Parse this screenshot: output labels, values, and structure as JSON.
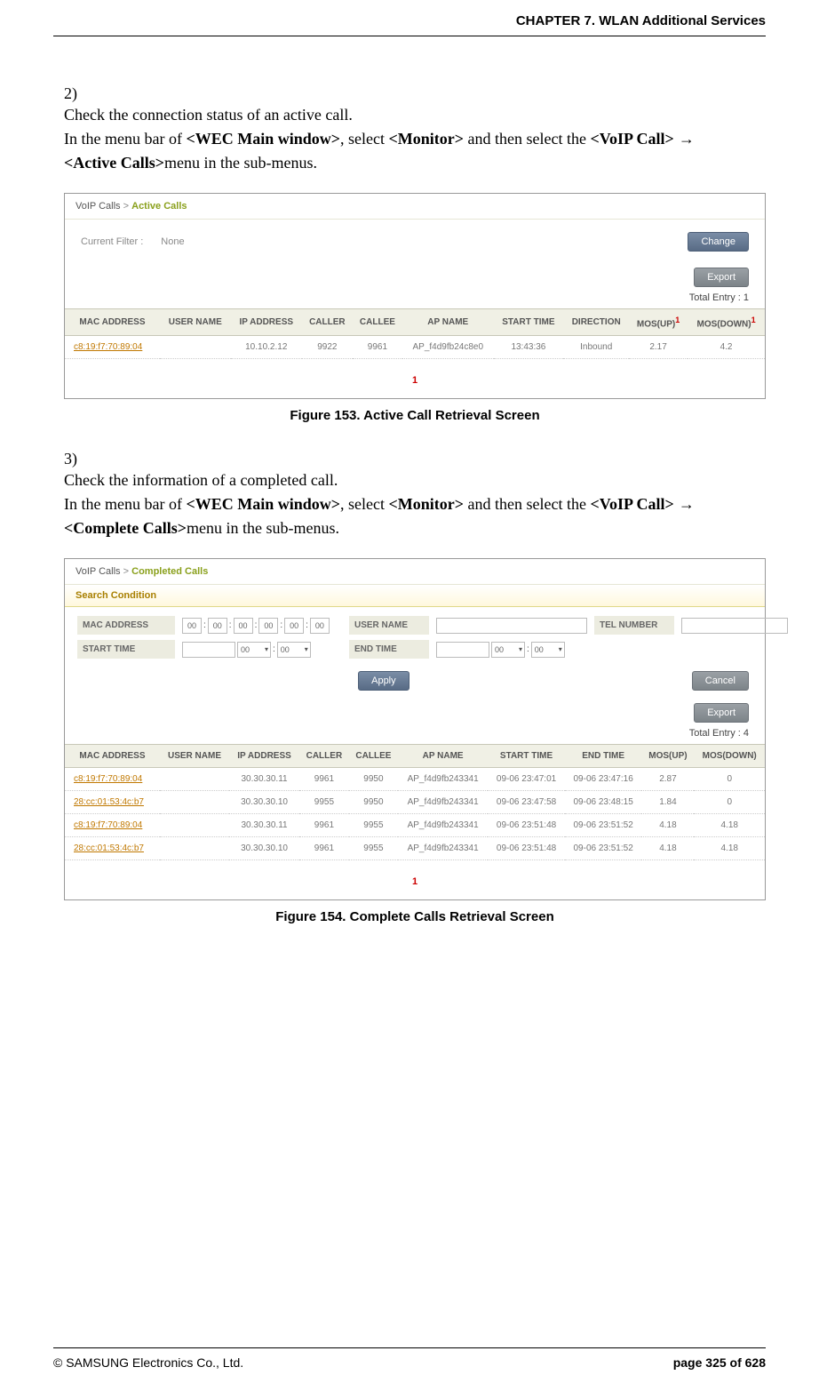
{
  "header": "CHAPTER 7. WLAN Additional Services",
  "step2": {
    "num": "2)",
    "line1": "Check the connection status of an active call.",
    "line2a": "In the menu bar of ",
    "wec": "<WEC Main window>",
    "line2b": ", select ",
    "monitor": "<Monitor>",
    "line2c": " and then select the ",
    "voip": "<VoIP Call>",
    "arrow": " → ",
    "active": "<Active Calls>",
    "line2d": "menu in the sub-menus."
  },
  "fig1": {
    "crumb1": "VoIP Calls",
    "crumb_sep": ">",
    "crumb2": "Active Calls",
    "filter_label": "Current Filter :",
    "filter_value": "None",
    "change_btn": "Change",
    "export_btn": "Export",
    "total": "Total Entry : 1",
    "headers": [
      "MAC ADDRESS",
      "USER NAME",
      "IP ADDRESS",
      "CALLER",
      "CALLEE",
      "AP NAME",
      "START TIME",
      "DIRECTION",
      "MOS(UP)",
      "MOS(DOWN)"
    ],
    "row": {
      "mac": "c8:19:f7:70:89:04",
      "user": "",
      "ip": "10.10.2.12",
      "caller": "9922",
      "callee": "9961",
      "ap": "AP_f4d9fb24c8e0",
      "start": "13:43:36",
      "dir": "Inbound",
      "mosup": "2.17",
      "mosdn": "4.2"
    },
    "pager": "1",
    "caption": "Figure 153. Active Call Retrieval Screen"
  },
  "step3": {
    "num": "3)",
    "line1": "Check the information of a completed call.",
    "line2a": "In the menu bar of ",
    "wec": "<WEC Main window>",
    "line2b": ", select ",
    "monitor": "<Monitor>",
    "line2c": " and then select the ",
    "voip": "<VoIP Call>",
    "arrow": " → ",
    "complete": "<Complete Calls>",
    "line2d": "menu in the sub-menus."
  },
  "fig2": {
    "crumb1": "VoIP Calls",
    "crumb_sep": ">",
    "crumb2": "Completed Calls",
    "search_tab": "Search Condition",
    "labels": {
      "mac": "MAC ADDRESS",
      "user": "USER NAME",
      "tel": "TEL NUMBER",
      "start": "START TIME",
      "end": "END TIME"
    },
    "mac_zero": "00",
    "time_zero": "00",
    "apply_btn": "Apply",
    "cancel_btn": "Cancel",
    "export_btn": "Export",
    "total": "Total Entry : 4",
    "headers": [
      "MAC ADDRESS",
      "USER NAME",
      "IP ADDRESS",
      "CALLER",
      "CALLEE",
      "AP NAME",
      "START TIME",
      "END TIME",
      "MOS(UP)",
      "MOS(DOWN)"
    ],
    "rows": [
      {
        "mac": "c8:19:f7:70:89:04",
        "user": "",
        "ip": "30.30.30.11",
        "caller": "9961",
        "callee": "9950",
        "ap": "AP_f4d9fb243341",
        "start": "09-06 23:47:01",
        "end": "09-06 23:47:16",
        "mosup": "2.87",
        "mosdn": "0"
      },
      {
        "mac": "28:cc:01:53:4c:b7",
        "user": "",
        "ip": "30.30.30.10",
        "caller": "9955",
        "callee": "9950",
        "ap": "AP_f4d9fb243341",
        "start": "09-06 23:47:58",
        "end": "09-06 23:48:15",
        "mosup": "1.84",
        "mosdn": "0"
      },
      {
        "mac": "c8:19:f7:70:89:04",
        "user": "",
        "ip": "30.30.30.11",
        "caller": "9961",
        "callee": "9955",
        "ap": "AP_f4d9fb243341",
        "start": "09-06 23:51:48",
        "end": "09-06 23:51:52",
        "mosup": "4.18",
        "mosdn": "4.18"
      },
      {
        "mac": "28:cc:01:53:4c:b7",
        "user": "",
        "ip": "30.30.30.10",
        "caller": "9961",
        "callee": "9955",
        "ap": "AP_f4d9fb243341",
        "start": "09-06 23:51:48",
        "end": "09-06 23:51:52",
        "mosup": "4.18",
        "mosdn": "4.18"
      }
    ],
    "pager": "1",
    "caption": "Figure 154. Complete Calls Retrieval Screen"
  },
  "footer": {
    "copyright": "© SAMSUNG Electronics Co., Ltd.",
    "page": "page 325 of 628"
  }
}
